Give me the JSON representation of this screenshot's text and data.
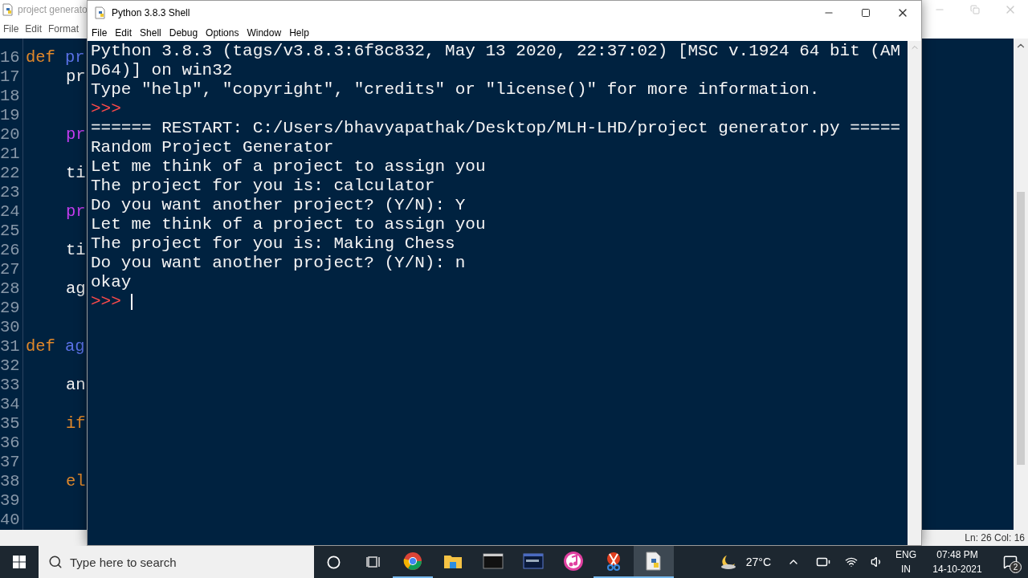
{
  "editor_window": {
    "title": "project generato",
    "active": false,
    "menu": [
      "File",
      "Edit",
      "Format"
    ],
    "code_lines": [
      {
        "number": "16",
        "indented": false,
        "tokens": [
          {
            "text": "def",
            "kind": "keyword"
          },
          {
            "text": "pr",
            "kind": "defname"
          }
        ]
      },
      {
        "number": "17",
        "indented": true,
        "tokens": [
          {
            "text": "pr",
            "kind": "plain"
          }
        ]
      },
      {
        "number": "18"
      },
      {
        "number": "19"
      },
      {
        "number": "20",
        "indented": true,
        "tokens": [
          {
            "text": "pr",
            "kind": "builtin"
          }
        ]
      },
      {
        "number": "21"
      },
      {
        "number": "22",
        "indented": true,
        "tokens": [
          {
            "text": "ti",
            "kind": "plain"
          }
        ]
      },
      {
        "number": "23"
      },
      {
        "number": "24",
        "indented": true,
        "tokens": [
          {
            "text": "pr",
            "kind": "builtin"
          }
        ]
      },
      {
        "number": "25"
      },
      {
        "number": "26",
        "indented": true,
        "tokens": [
          {
            "text": "ti",
            "kind": "plain"
          }
        ]
      },
      {
        "number": "27"
      },
      {
        "number": "28",
        "indented": true,
        "tokens": [
          {
            "text": "ag",
            "kind": "plain"
          }
        ]
      },
      {
        "number": "29"
      },
      {
        "number": "30"
      },
      {
        "number": "31",
        "indented": false,
        "tokens": [
          {
            "text": "def",
            "kind": "keyword"
          },
          {
            "text": "ag",
            "kind": "defname"
          }
        ]
      },
      {
        "number": "32"
      },
      {
        "number": "33",
        "indented": true,
        "tokens": [
          {
            "text": "an",
            "kind": "plain"
          }
        ]
      },
      {
        "number": "34"
      },
      {
        "number": "35",
        "indented": true,
        "tokens": [
          {
            "text": "if",
            "kind": "keyword"
          }
        ]
      },
      {
        "number": "36"
      },
      {
        "number": "37"
      },
      {
        "number": "38",
        "indented": true,
        "tokens": [
          {
            "text": "el",
            "kind": "keyword"
          }
        ]
      },
      {
        "number": "39"
      },
      {
        "number": "40"
      }
    ],
    "status": "Ln: 26 Col: 16"
  },
  "shell_window": {
    "title": "Python 3.8.3 Shell",
    "active": true,
    "menu": [
      "File",
      "Edit",
      "Shell",
      "Debug",
      "Options",
      "Window",
      "Help"
    ],
    "lines": [
      {
        "kind": "output",
        "text": "Python 3.8.3 (tags/v3.8.3:6f8c832, May 13 2020, 22:37:02) [MSC v.1924 64 bit (AM"
      },
      {
        "kind": "output",
        "text": "D64)] on win32"
      },
      {
        "kind": "output",
        "text": "Type \"help\", \"copyright\", \"credits\" or \"license()\" for more information."
      },
      {
        "kind": "prompt",
        "text": ">>>"
      },
      {
        "kind": "output",
        "text": "====== RESTART: C:/Users/bhavyapathak/Desktop/MLH-LHD/project generator.py ====="
      },
      {
        "kind": "output",
        "text": "Random Project Generator"
      },
      {
        "kind": "output",
        "text": "Let me think of a project to assign you"
      },
      {
        "kind": "output",
        "text": "The project for you is: calculator"
      },
      {
        "kind": "output",
        "text": "Do you want another project? (Y/N): Y"
      },
      {
        "kind": "output",
        "text": "Let me think of a project to assign you"
      },
      {
        "kind": "output",
        "text": "The project for you is: Making Chess"
      },
      {
        "kind": "output",
        "text": "Do you want another project? (Y/N): n"
      },
      {
        "kind": "output",
        "text": "okay"
      },
      {
        "kind": "prompt",
        "text": ">>>",
        "cursor": true
      }
    ]
  },
  "taskbar": {
    "search": {
      "placeholder": "Type here to search"
    },
    "apps": [
      {
        "kind": "chrome",
        "running": true,
        "selected": false
      },
      {
        "kind": "folder",
        "running": false,
        "selected": false
      },
      {
        "kind": "terminal",
        "running": false,
        "selected": false
      },
      {
        "kind": "dbterminal",
        "running": false,
        "selected": false
      },
      {
        "kind": "music",
        "running": false,
        "selected": false
      },
      {
        "kind": "scissors",
        "running": true,
        "selected": false
      },
      {
        "kind": "idle",
        "running": true,
        "selected": true
      }
    ],
    "weather": "27°C",
    "language": "ENG",
    "region": "IN",
    "time": "07:48 PM",
    "date": "14-10-2021",
    "notifications": "2"
  }
}
